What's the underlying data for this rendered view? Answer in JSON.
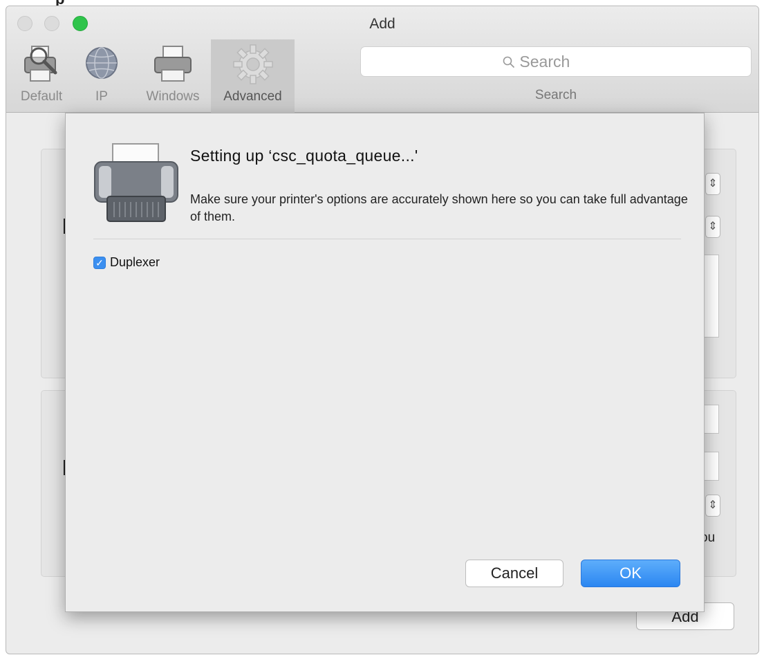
{
  "top_sliver": {
    "text": "p"
  },
  "window": {
    "title": "Add"
  },
  "toolbar": {
    "items": [
      {
        "label": "Default",
        "icon": "printer-magnifier-icon"
      },
      {
        "label": "IP",
        "icon": "globe-icon"
      },
      {
        "label": "Windows",
        "icon": "printer-icon"
      },
      {
        "label": "Advanced",
        "icon": "gear-icon",
        "selected": true
      }
    ],
    "search_placeholder": "Search",
    "search_label": "Search"
  },
  "background": {
    "add_button_label": "Add",
    "cut_text_right": "ou"
  },
  "sheet": {
    "title": "Setting up ‘csc_quota_queue...'",
    "message": "Make sure your printer's options are accurately shown here so you can take full advantage of them.",
    "options": [
      {
        "label": "Duplexer",
        "checked": true
      }
    ],
    "cancel_label": "Cancel",
    "ok_label": "OK"
  },
  "colors": {
    "accent": "#2b86f1",
    "zoom": "#2fc44b"
  }
}
